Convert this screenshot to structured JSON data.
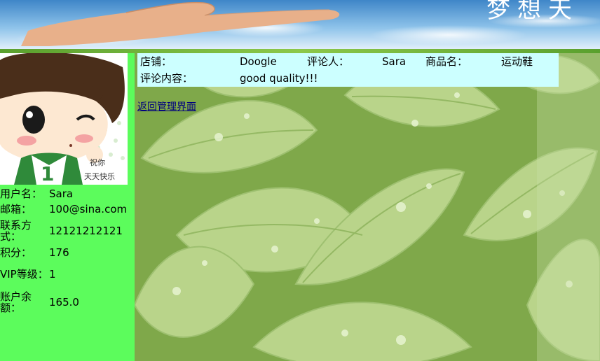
{
  "banner": {
    "decor_text": "梦想天"
  },
  "sidebar": {
    "user_info": [
      {
        "label": "用户名：",
        "value": "Sara"
      },
      {
        "label": "邮箱：",
        "value": "100@sina.com"
      },
      {
        "label": "联系方式：",
        "value": "12121212121"
      },
      {
        "label": "积分：",
        "value": "176"
      },
      {
        "label": "VIP等级：",
        "value": "1"
      },
      {
        "label": "账户余额：",
        "value": "165.0"
      }
    ],
    "avatar_caption_line1": "祝你",
    "avatar_caption_line2": "天天快乐",
    "avatar_shirt_number": "1"
  },
  "comment": {
    "shop_label": "店铺：",
    "shop_value": "Doogle",
    "reviewer_label": "评论人：",
    "reviewer_value": "Sara",
    "product_label": "商品名：",
    "product_value": "运动鞋",
    "content_label": "评论内容：",
    "content_value": "good quality!!!"
  },
  "links": {
    "back": "返回管理界面"
  },
  "colors": {
    "sidebar_bg": "#5cfc5c",
    "comment_bg": "#ccffff",
    "link": "#00007f"
  }
}
